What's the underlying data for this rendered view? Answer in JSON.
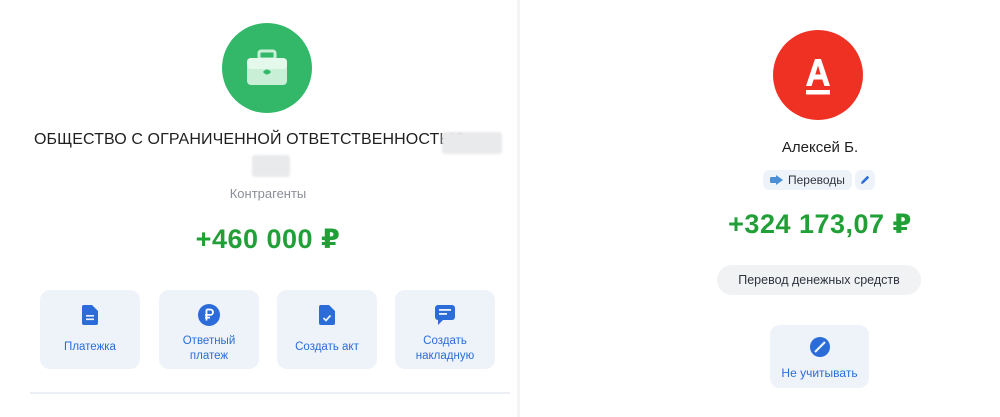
{
  "colors": {
    "accent_green": "#21a038",
    "avatar_green": "#33b86a",
    "alfa_red": "#ef3124",
    "action_blue": "#2b6cd9",
    "button_bg": "#eef3fa"
  },
  "left_panel": {
    "avatar_icon": "briefcase-icon",
    "company_name": "ОБЩЕСТВО С ОГРАНИЧЕННОЙ ОТВЕТСТВЕННОСТЬЮ",
    "category": "Контрагенты",
    "amount": "+460 000 ₽",
    "actions": [
      {
        "label": "Платежка",
        "icon": "document-icon"
      },
      {
        "label": "Ответный платеж",
        "icon": "ruble-icon"
      },
      {
        "label": "Создать акт",
        "icon": "document-check-icon"
      },
      {
        "label": "Создать накладную",
        "icon": "invoice-icon"
      }
    ]
  },
  "right_panel": {
    "avatar_icon": "alfa-logo",
    "person_name": "Алексей Б.",
    "category_chip": "Переводы",
    "category_chip_icon": "transfer-arrow-icon",
    "edit_icon": "pencil-icon",
    "amount": "+324 173,07 ₽",
    "description": "Перевод денежных средств",
    "ignore_button": "Не учитывать",
    "ignore_icon": "exclude-icon"
  }
}
